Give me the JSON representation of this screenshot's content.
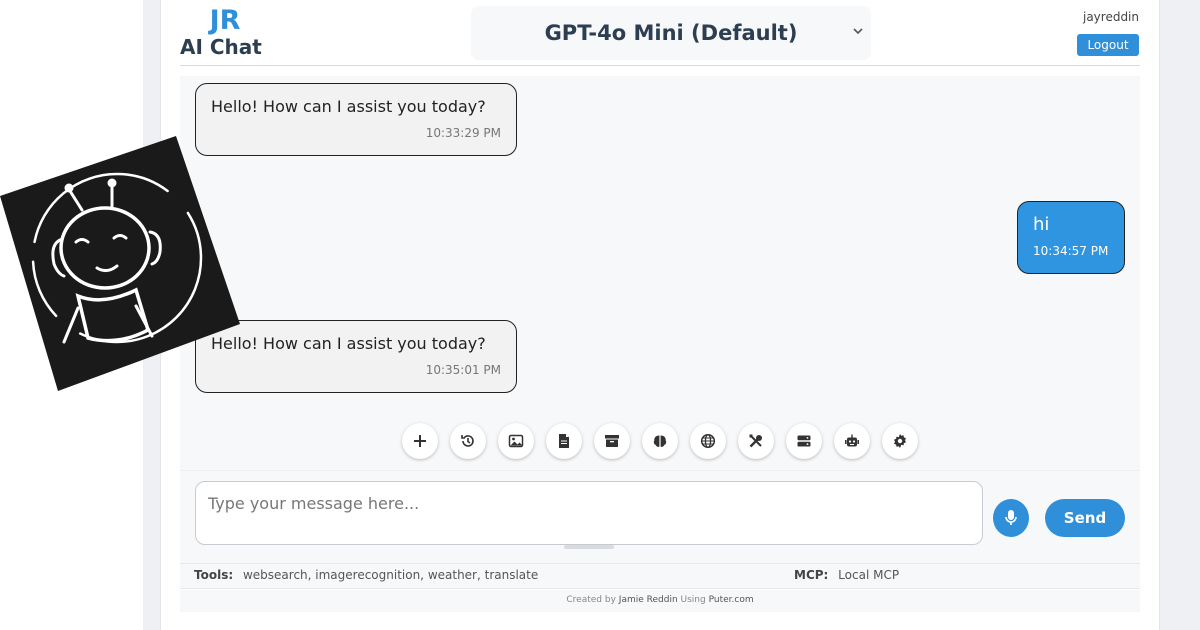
{
  "brand": {
    "short": "JR",
    "title": "AI Chat"
  },
  "model_selector": {
    "selected": "GPT-4o Mini (Default)"
  },
  "user": {
    "name": "jayreddin",
    "logout_label": "Logout"
  },
  "messages": [
    {
      "role": "assistant",
      "text": "Hello! How can I assist you today?",
      "time": "10:33:29 PM"
    },
    {
      "role": "user",
      "text": "hi",
      "time": "10:34:57 PM"
    },
    {
      "role": "assistant",
      "text": "Hello! How can I assist you today?",
      "time": "10:35:01 PM"
    }
  ],
  "toolbar": {
    "icons": [
      "plus-icon",
      "history-icon",
      "image-icon",
      "file-icon",
      "archive-icon",
      "brain-icon",
      "globe-icon",
      "tools-icon",
      "server-icon",
      "robot-icon",
      "gear-icon"
    ]
  },
  "composer": {
    "placeholder": "Type your message here...",
    "value": "",
    "send_label": "Send"
  },
  "info": {
    "tools_label": "Tools:",
    "tools_value": "websearch, imagerecognition, weather, translate",
    "mcp_label": "MCP:",
    "mcp_value": "Local MCP"
  },
  "footer": {
    "prefix": "Created by",
    "author": "Jamie Reddin",
    "middle": "Using",
    "site": "Puter.com"
  },
  "colors": {
    "accent": "#2f8fd8",
    "user_bubble": "#2f95e0",
    "assistant_bubble": "#f2f2f3",
    "text_dark": "#2c3e50"
  }
}
